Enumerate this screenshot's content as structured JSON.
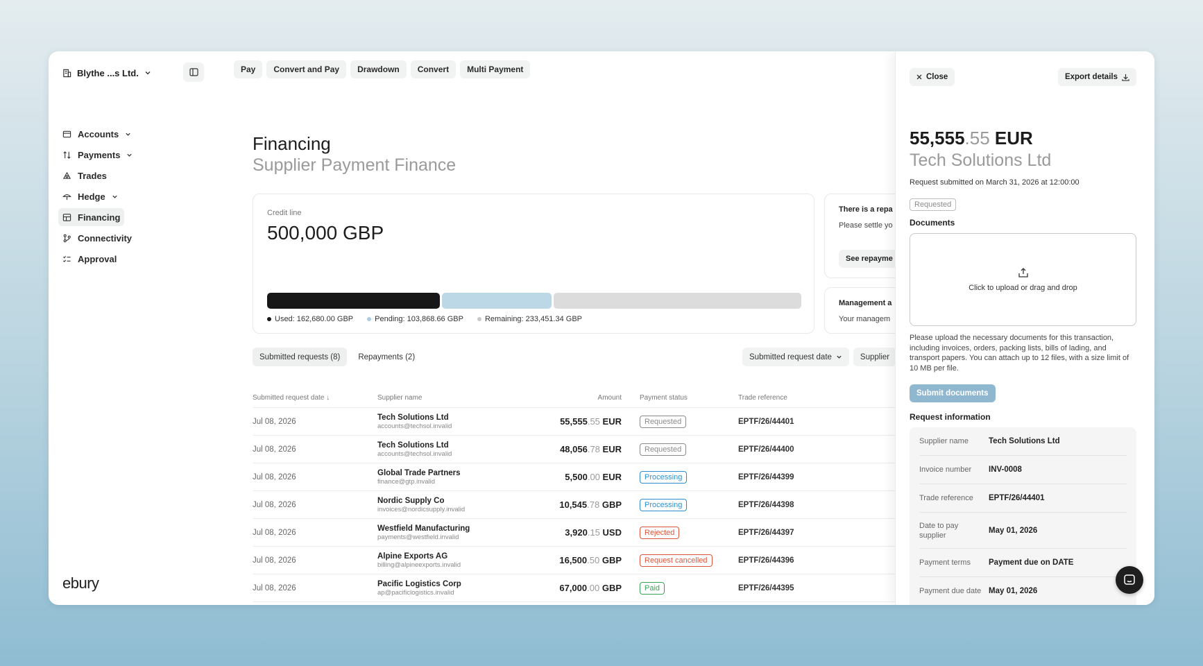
{
  "org": {
    "name": "Blythe ...s Ltd."
  },
  "nav": [
    {
      "label": "Accounts",
      "icon": "accounts-icon",
      "chevron": true
    },
    {
      "label": "Payments",
      "icon": "payments-icon",
      "chevron": true
    },
    {
      "label": "Trades",
      "icon": "trades-icon",
      "chevron": false
    },
    {
      "label": "Hedge",
      "icon": "hedge-icon",
      "chevron": true
    },
    {
      "label": "Financing",
      "icon": "financing-icon",
      "chevron": false,
      "active": true
    },
    {
      "label": "Connectivity",
      "icon": "connectivity-icon",
      "chevron": false
    },
    {
      "label": "Approval",
      "icon": "approval-icon",
      "chevron": false
    }
  ],
  "logo": "ebury",
  "topbar": [
    "Pay",
    "Convert and Pay",
    "Drawdown",
    "Convert",
    "Multi Payment"
  ],
  "page": {
    "title": "Financing",
    "subtitle": "Supplier Payment Finance"
  },
  "credit": {
    "label": "Credit line",
    "value": "500,000 GBP",
    "used": 162680.0,
    "pending": 103868.66,
    "remaining": 233451.34,
    "used_label": "Used: 162,680.00 GBP",
    "pending_label": "Pending: 103,868.66 GBP",
    "remaining_label": "Remaining: 233,451.34 GBP",
    "colors": {
      "used": "#171717",
      "pending": "#bcd7e6",
      "remaining": "#dcdcdc"
    }
  },
  "repay_card": {
    "title": "There is a repa",
    "text": "Please settle yo requests.",
    "button": "See repayme"
  },
  "mgmt_card": {
    "title": "Management a",
    "text": "Your managem"
  },
  "tabs": [
    "Submitted requests (8)",
    "Repayments (2)"
  ],
  "filters": {
    "sort": "Submitted request date",
    "supplier": "Supplier"
  },
  "table": {
    "headers": {
      "date": "Submitted request date ↓",
      "supplier": "Supplier name",
      "amount": "Amount",
      "status": "Payment status",
      "ref": "Trade reference"
    },
    "rows": [
      {
        "date": "Jul 08, 2026",
        "supplier": "Tech Solutions Ltd",
        "email": "accounts@techsol.invalid",
        "amt_int": "55,555",
        "amt_dec": ".55",
        "currency": "EUR",
        "status": "Requested",
        "ref": "EPTF/26/44401"
      },
      {
        "date": "Jul 08, 2026",
        "supplier": "Tech Solutions Ltd",
        "email": "accounts@techsol.invalid",
        "amt_int": "48,056",
        "amt_dec": ".78",
        "currency": "EUR",
        "status": "Requested",
        "ref": "EPTF/26/44400"
      },
      {
        "date": "Jul 08, 2026",
        "supplier": "Global Trade Partners",
        "email": "finance@gtp.invalid",
        "amt_int": "5,500",
        "amt_dec": ".00",
        "currency": "EUR",
        "status": "Processing",
        "ref": "EPTF/26/44399"
      },
      {
        "date": "Jul 08, 2026",
        "supplier": "Nordic Supply Co",
        "email": "invoices@nordicsupply.invalid",
        "amt_int": "10,545",
        "amt_dec": ".78",
        "currency": "GBP",
        "status": "Processing",
        "ref": "EPTF/26/44398"
      },
      {
        "date": "Jul 08, 2026",
        "supplier": "Westfield Manufacturing",
        "email": "payments@westfield.invalid",
        "amt_int": "3,920",
        "amt_dec": ".15",
        "currency": "USD",
        "status": "Rejected",
        "ref": "EPTF/26/44397"
      },
      {
        "date": "Jul 08, 2026",
        "supplier": "Alpine Exports AG",
        "email": "billing@alpineexports.invalid",
        "amt_int": "16,500",
        "amt_dec": ".50",
        "currency": "GBP",
        "status": "Request cancelled",
        "ref": "EPTF/26/44396"
      },
      {
        "date": "Jul 08, 2026",
        "supplier": "Pacific Logistics Corp",
        "email": "ap@pacificlogistics.invalid",
        "amt_int": "67,000",
        "amt_dec": ".00",
        "currency": "GBP",
        "status": "Paid",
        "ref": "EPTF/26/44395"
      }
    ]
  },
  "status_colors": {
    "Requested": "#8a8a8a",
    "Processing": "#2e8fd0",
    "Rejected": "#e0553a",
    "Request cancelled": "#e0553a",
    "Paid": "#3aa655"
  },
  "panel": {
    "close": "Close",
    "export": "Export details",
    "amount_int": "55,555",
    "amount_dec": ".55",
    "amount_cur": " EUR",
    "supplier": "Tech Solutions Ltd",
    "submitted": "Request submitted on March 31, 2026 at 12:00:00",
    "status": "Requested",
    "documents_heading": "Documents",
    "dropzone_text": "Click to upload or drag and drop",
    "help": "Please upload the necessary documents for this transaction, including invoices, orders, packing lists, bills of lading, and transport papers. You can attach up to 12 files, with a size limit of 10 MB per file.",
    "submit": "Submit documents",
    "info_heading": "Request information",
    "info": [
      {
        "k": "Supplier name",
        "v": "Tech Solutions Ltd"
      },
      {
        "k": "Invoice number",
        "v": "INV-0008"
      },
      {
        "k": "Trade reference",
        "v": "EPTF/26/44401"
      },
      {
        "k": "Date to pay supplier",
        "v": "May 01, 2026"
      },
      {
        "k": "Payment terms",
        "v": "Payment due on DATE"
      },
      {
        "k": "Payment due date",
        "v": "May 01, 2026"
      }
    ]
  }
}
